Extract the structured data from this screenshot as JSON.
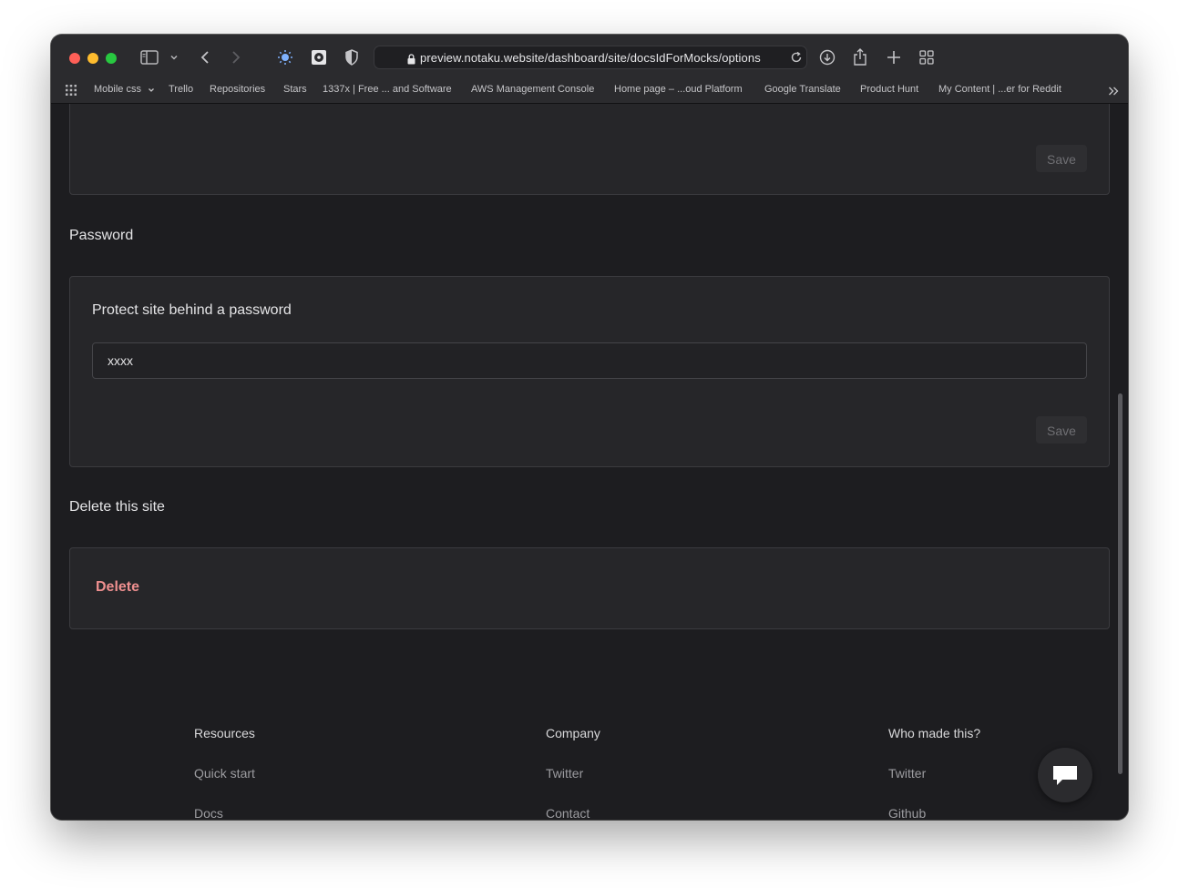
{
  "browser": {
    "url": "preview.notaku.website/dashboard/site/docsIdForMocks/options",
    "bookmarks": [
      "Mobile css",
      "Trello",
      "Repositories",
      "Stars",
      "1337x | Free ... and Software",
      "AWS Management Console",
      "Home page – ...oud Platform",
      "Google Translate",
      "Product Hunt",
      "My Content | ...er for Reddit"
    ]
  },
  "top_card": {
    "save_label": "Save"
  },
  "password_section": {
    "title": "Password",
    "label": "Protect site behind a password",
    "input_value": "xxxx",
    "save_label": "Save"
  },
  "delete_section": {
    "title": "Delete this site",
    "delete_label": "Delete"
  },
  "footer": {
    "columns": [
      {
        "heading": "Resources",
        "links": [
          "Quick start",
          "Docs"
        ]
      },
      {
        "heading": "Company",
        "links": [
          "Twitter",
          "Contact"
        ]
      },
      {
        "heading": "Who made this?",
        "links": [
          "Twitter",
          "Github"
        ]
      }
    ]
  },
  "colors": {
    "background": "#1d1d20",
    "card": "#262629",
    "danger": "#ee8f8f"
  }
}
